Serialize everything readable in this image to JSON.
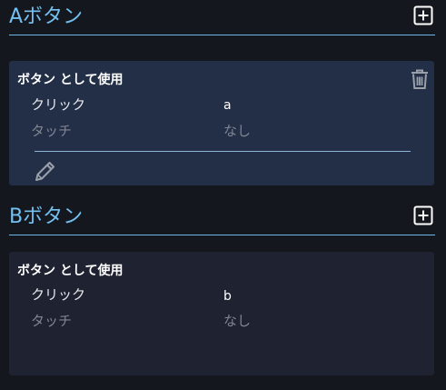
{
  "sections": [
    {
      "title": "Aボタン",
      "add_icon": "add-box-icon",
      "card": {
        "title": "ボタン として使用",
        "rows": [
          {
            "label": "クリック",
            "value": "a"
          },
          {
            "label": "タッチ",
            "value": "なし"
          }
        ],
        "delete_icon": "trash-icon",
        "edit_icon": "pencil-icon"
      }
    },
    {
      "title": "Bボタン",
      "add_icon": "add-box-icon",
      "card": {
        "title": "ボタン として使用",
        "rows": [
          {
            "label": "クリック",
            "value": "b"
          },
          {
            "label": "タッチ",
            "value": "なし"
          }
        ]
      }
    }
  ],
  "colors": {
    "background": "#14171e",
    "accent": "#74c0f0",
    "selected_card": "#222f47",
    "card": "#1f2230",
    "muted_text": "#808590"
  }
}
